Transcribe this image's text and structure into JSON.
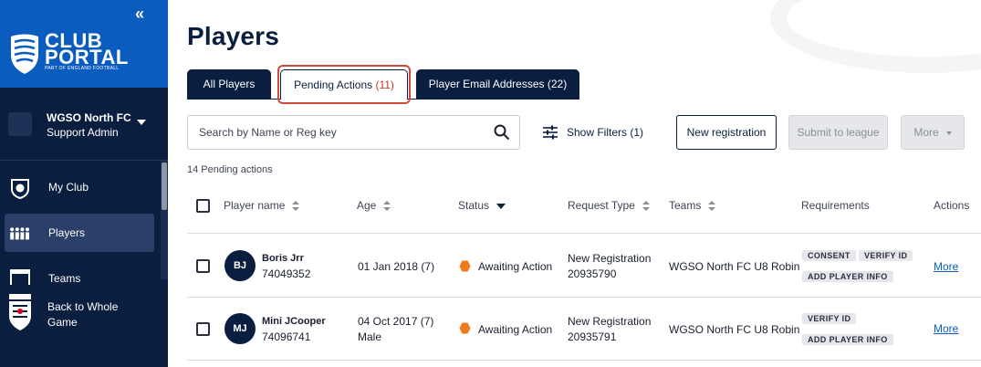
{
  "sidebar": {
    "brand": {
      "title": "CLUB PORTAL",
      "subtitle": "PART OF ENGLAND FOOTBALL"
    },
    "org": {
      "name": "WGSO North FC",
      "role": "Support Admin"
    },
    "nav": [
      {
        "label": "My Club",
        "icon": "shield-icon"
      },
      {
        "label": "Players",
        "icon": "people-icon"
      },
      {
        "label": "Teams",
        "icon": "teams-icon"
      }
    ],
    "back": {
      "line1": "Back to Whole",
      "line2": "Game"
    }
  },
  "main": {
    "title": "Players",
    "tabs": [
      {
        "label": "All Players"
      },
      {
        "label": "Pending Actions",
        "count": "(11)"
      },
      {
        "label": "Player Email Addresses (22)"
      }
    ],
    "search": {
      "placeholder": "Search by Name or Reg key"
    },
    "filters_label": "Show Filters (1)",
    "buttons": {
      "new_registration": "New registration",
      "submit": "Submit to league",
      "more": "More"
    },
    "pending_count": "14 Pending actions",
    "columns": [
      "Player name",
      "Age",
      "Status",
      "Request Type",
      "Teams",
      "Requirements",
      "Actions"
    ],
    "rows": [
      {
        "initials": "BJ",
        "name": "Boris Jrr",
        "id": "74049352",
        "age_line1": "01 Jan 2018 (7)",
        "age_line2": "",
        "status": "Awaiting Action",
        "request_type": "New Registration",
        "request_id": "20935790",
        "team": "WGSO North FC U8 Robin",
        "requirements": [
          "CONSENT",
          "VERIFY ID",
          "ADD PLAYER INFO"
        ],
        "action": "More"
      },
      {
        "initials": "MJ",
        "name": "Mini JCooper",
        "id": "74096741",
        "age_line1": "04 Oct 2017 (7)",
        "age_line2": "Male",
        "status": "Awaiting Action",
        "request_type": "New Registration",
        "request_id": "20935791",
        "team": "WGSO North FC U8 Robin",
        "requirements": [
          "VERIFY ID",
          "ADD PLAYER INFO"
        ],
        "action": "More"
      }
    ]
  },
  "colors": {
    "navy": "#0a1e3f",
    "brand_blue": "#0b5cbf",
    "status_orange": "#f07a1a",
    "count_red": "#c0392b"
  }
}
